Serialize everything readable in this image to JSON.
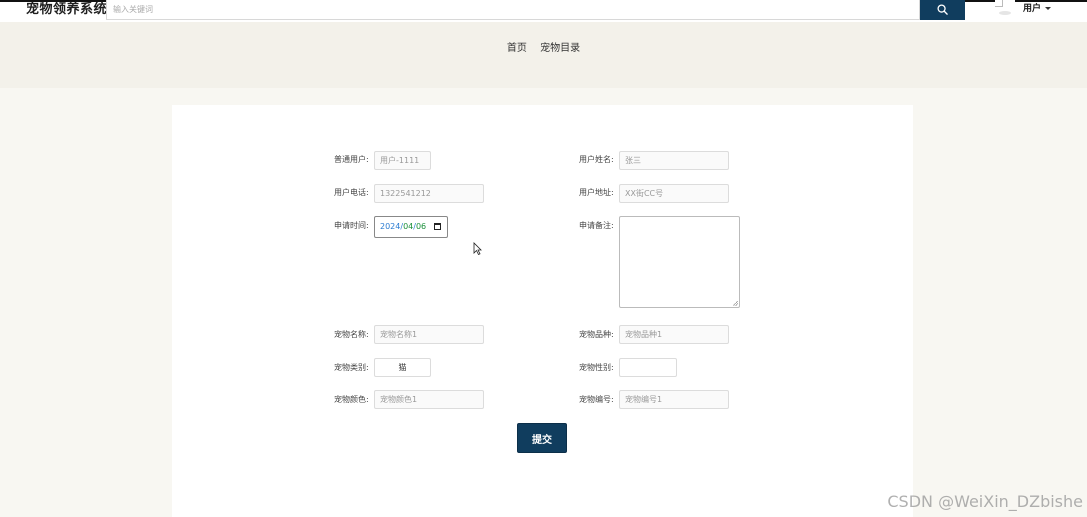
{
  "header": {
    "app_title": "宠物领养系统",
    "search": {
      "placeholder": "输入关键词",
      "button_icon": "search-icon"
    },
    "user_menu": {
      "label": "用户",
      "avatar_icon": "avatar-icon"
    },
    "nav": [
      "首页",
      "宠物目录"
    ]
  },
  "form": {
    "fields": {
      "regular_user": {
        "label": "普通用户:",
        "value": "用户-1111"
      },
      "user_name": {
        "label": "用户姓名:",
        "value": "张三"
      },
      "user_phone": {
        "label": "用户电话:",
        "value": "1322541212"
      },
      "user_address": {
        "label": "用户地址:",
        "value": "XX街CC号"
      },
      "apply_time": {
        "label": "申请时间:",
        "year": "2024",
        "month": "04",
        "day": "06",
        "separator": "/"
      },
      "apply_note": {
        "label": "申请备注:",
        "value": ""
      },
      "pet_name": {
        "label": "宠物名称:",
        "value": "宠物名称1"
      },
      "pet_breed": {
        "label": "宠物品种:",
        "value": "宠物品种1"
      },
      "pet_category": {
        "label": "宠物类别:",
        "value": "猫"
      },
      "pet_gender": {
        "label": "宠物性别:",
        "value": ""
      },
      "pet_color": {
        "label": "宠物颜色:",
        "value": "宠物颜色1"
      },
      "pet_number": {
        "label": "宠物编号:",
        "value": "宠物编号1"
      }
    },
    "submit_label": "提交"
  },
  "watermark": "CSDN @WeiXin_DZbishe",
  "colors": {
    "accent": "#103d5e",
    "header_bg": "#f3f1ea",
    "page_bg": "#f8f7f2",
    "card_bg": "#ffffff"
  }
}
